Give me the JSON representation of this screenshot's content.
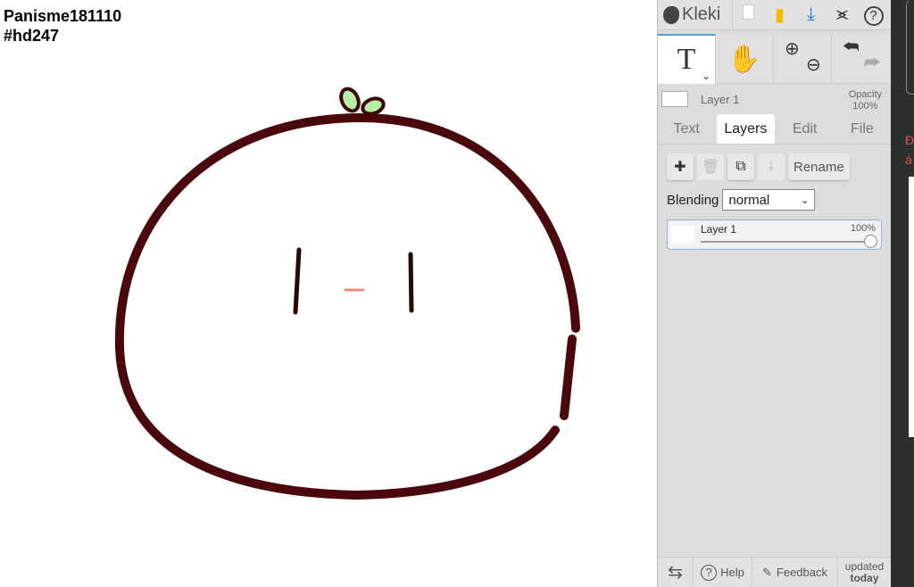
{
  "caption": {
    "line1": "Panisme181110",
    "line2": "#hd247"
  },
  "app": {
    "name": "Kleki"
  },
  "layer_info": {
    "name": "Layer 1",
    "opacity_label": "Opacity",
    "opacity_value": "100%"
  },
  "tabs": [
    {
      "label": "Text"
    },
    {
      "label": "Layers"
    },
    {
      "label": "Edit"
    },
    {
      "label": "File"
    }
  ],
  "layers": {
    "rename_label": "Rename",
    "blending_label": "Blending",
    "blending_value": "normal",
    "items": [
      {
        "name": "Layer 1",
        "opacity": "100%",
        "opacity_fraction": 1.0
      }
    ]
  },
  "footer": {
    "help": "Help",
    "feedback": "Feedback",
    "updated": "updated",
    "today": "today"
  },
  "right_panel": {
    "text_fragment_1": "Đ",
    "text_fragment_2": "á"
  },
  "colors": {
    "outline": "#4a080c",
    "leaf": "#b8f0a8",
    "mouth": "#f08a80",
    "accent": "#1a73e8"
  }
}
